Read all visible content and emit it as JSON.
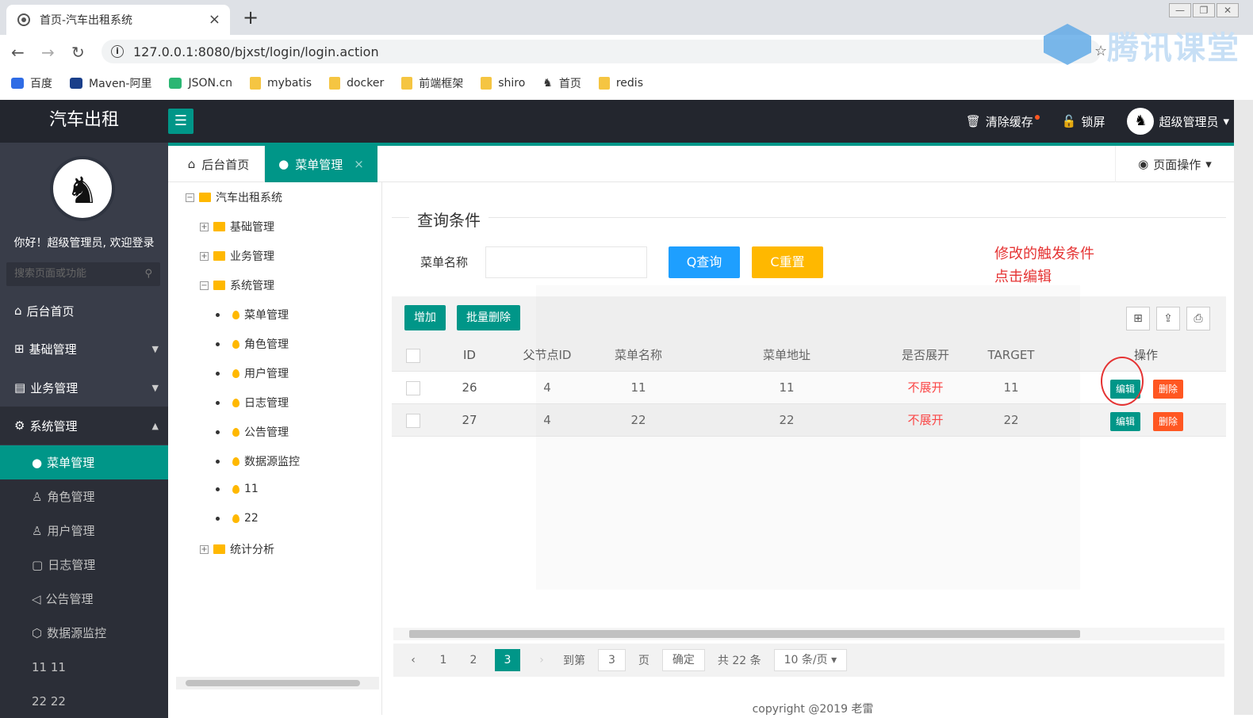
{
  "browser": {
    "tab_title": "首页-汽车出租系统",
    "tab_close": "×",
    "new_tab": "+",
    "url": "127.0.0.1:8080/bjxst/login/login.action",
    "bookmarks": [
      "百度",
      "Maven-阿里",
      "JSON.cn",
      "mybatis",
      "docker",
      "前端框架",
      "shiro",
      "首页",
      "redis"
    ],
    "watermark": "腾讯课堂"
  },
  "header": {
    "logo": "汽车出租",
    "clear_cache": "清除缓存",
    "lock_screen": "锁屏",
    "user": "超级管理员"
  },
  "sidebar": {
    "welcome": "你好！超级管理员, 欢迎登录",
    "search_placeholder": "搜索页面或功能",
    "items": [
      "后台首页",
      "基础管理",
      "业务管理",
      "系统管理"
    ],
    "subitems": [
      "菜单管理",
      "角色管理",
      "用户管理",
      "日志管理",
      "公告管理",
      "数据源监控",
      "11 11",
      "22 22"
    ]
  },
  "tabs": {
    "home": "后台首页",
    "menu": "菜单管理",
    "close": "×",
    "page_ops": "页面操作"
  },
  "tree": {
    "root": "汽车出租系统",
    "n1": "基础管理",
    "n2": "业务管理",
    "n3": "系统管理",
    "leaves": [
      "菜单管理",
      "角色管理",
      "用户管理",
      "日志管理",
      "公告管理",
      "数据源监控",
      "11",
      "22"
    ],
    "n4": "统计分析"
  },
  "search": {
    "legend": "查询条件",
    "label": "菜单名称",
    "query_btn": "Q查询",
    "reset_btn": "C重置"
  },
  "annotation": {
    "line1": "修改的触发条件",
    "line2": "点击编辑"
  },
  "toolbar": {
    "add": "增加",
    "batch_delete": "批量删除"
  },
  "table": {
    "headers": [
      "ID",
      "父节点ID",
      "菜单名称",
      "菜单地址",
      "是否展开",
      "TARGET",
      "操作"
    ],
    "rows": [
      {
        "id": "26",
        "pid": "4",
        "name": "11",
        "href": "11",
        "spread": "不展开",
        "target": "11",
        "edit": "编辑",
        "del": "删除"
      },
      {
        "id": "27",
        "pid": "4",
        "name": "22",
        "href": "22",
        "spread": "不展开",
        "target": "22",
        "edit": "编辑",
        "del": "删除"
      }
    ]
  },
  "pager": {
    "pages": [
      "1",
      "2",
      "3"
    ],
    "goto": "到第",
    "goto_val": "3",
    "page_unit": "页",
    "confirm": "确定",
    "total": "共 22 条",
    "per_page": "10 条/页"
  },
  "footer": "copyright @2019 老雷"
}
